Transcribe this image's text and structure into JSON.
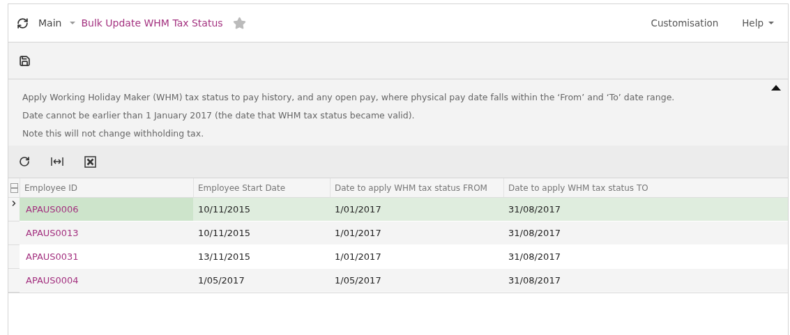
{
  "header": {
    "breadcrumb": "Main",
    "title": "Bulk Update WHM Tax Status",
    "favorite": false,
    "menu": [
      {
        "label": "Customisation",
        "dropdown": false
      },
      {
        "label": "Help",
        "dropdown": true
      }
    ]
  },
  "description": {
    "expanded": true,
    "lines": [
      "Apply Working Holiday Maker (WHM) tax status to pay history, and any open pay, where physical pay date falls within the ‘From’ and ‘To’ date range.",
      "Date cannot be earlier than 1 January 2017 (the date that WHM tax status became valid).",
      "Note this will not change withholding tax."
    ]
  },
  "table": {
    "columns": [
      "Employee ID",
      "Employee Start Date",
      "Date to apply WHM tax status FROM",
      "Date to apply WHM tax status TO"
    ],
    "rows": [
      {
        "selected": true,
        "cells": [
          "APAUS0006",
          "10/11/2015",
          "1/01/2017",
          "31/08/2017"
        ]
      },
      {
        "selected": false,
        "cells": [
          "APAUS0013",
          "10/11/2015",
          "1/01/2017",
          "31/08/2017"
        ]
      },
      {
        "selected": false,
        "cells": [
          "APAUS0031",
          "13/11/2015",
          "1/01/2017",
          "31/08/2017"
        ]
      },
      {
        "selected": false,
        "cells": [
          "APAUS0004",
          "1/05/2017",
          "1/05/2017",
          "31/08/2017"
        ]
      }
    ]
  }
}
